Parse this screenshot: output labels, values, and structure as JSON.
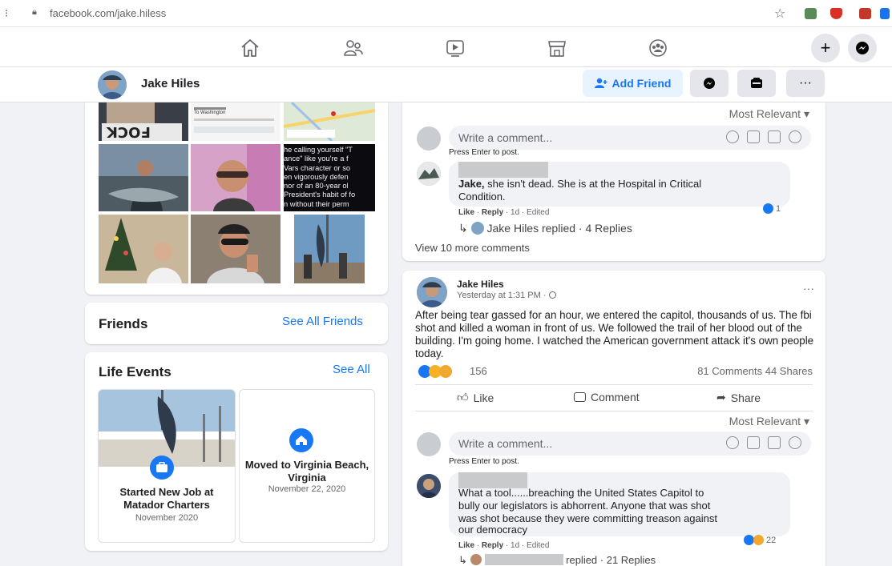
{
  "browser": {
    "url": "facebook.com/jake.hiless"
  },
  "nav": {
    "icons": [
      "home-icon",
      "friends-icon",
      "watch-icon",
      "marketplace-icon",
      "groups-icon"
    ],
    "plus": "+"
  },
  "profile": {
    "name": "Jake Hiles",
    "add_friend_label": "Add Friend",
    "more_label": "···"
  },
  "photos": {
    "overlay_text": [
      "he calling yourself \"T",
      "ance\" like you're a f",
      "Vars character or so",
      "en vigorously defen",
      "nor of an 80-year ol",
      "President's habit of fo",
      "n without their perm"
    ],
    "map_label": "To Washington"
  },
  "friends": {
    "title": "Friends",
    "see_all": "See All Friends"
  },
  "life_events": {
    "title": "Life Events",
    "see_all": "See All",
    "events": [
      {
        "title": "Started New Job at Matador Charters",
        "date": "November 2020"
      },
      {
        "title": "Moved to Virginia Beach, Virginia",
        "date": "November 22, 2020"
      }
    ]
  },
  "post1": {
    "most_relevant": "Most Relevant",
    "comment_placeholder": "Write a comment...",
    "press_enter": "Press Enter to post.",
    "comment": {
      "name_tag": "Jake,",
      "text_line1": "she isn't dead. She is at the Hospital in Critical",
      "text_line2": "Condition.",
      "meta_like": "Like",
      "meta_reply": "Reply",
      "meta_rest": "· 1d · Edited",
      "reaction_count": "1"
    },
    "replies": "Jake Hiles replied · 4 Replies",
    "view_more": "View 10 more comments"
  },
  "post2": {
    "author": "Jake Hiles",
    "time": "Yesterday at 1:31 PM ·",
    "more": "···",
    "text": "After being tear gassed for an hour, we entered the capitol, thousands of us.  The fbi shot and killed a woman in front of us. We followed the trail of her blood out of the building. I'm going home. I watched the American government attack it's own people today.",
    "reaction_count": "156",
    "comments_shares": "81 Comments 44 Shares",
    "like_label": "Like",
    "comment_label": "Comment",
    "share_label": "Share",
    "most_relevant": "Most Relevant",
    "comment_placeholder": "Write a comment...",
    "press_enter": "Press Enter to post.",
    "comment": {
      "text_line1": "What a tool......breaching the United States Capitol to",
      "text_line2": "bully our legislators is abhorrent. Anyone that was shot",
      "text_line3": "was shot because they were committing treason against",
      "text_line4": "our democracy",
      "meta_like": "Like",
      "meta_reply": "Reply",
      "meta_rest": "· 1d · Edited",
      "reaction_count": "22"
    },
    "replies": "replied · 21 Replies"
  },
  "colors": {
    "fb_blue": "#1877f2",
    "background": "#f0f2f5",
    "card": "#ffffff"
  }
}
